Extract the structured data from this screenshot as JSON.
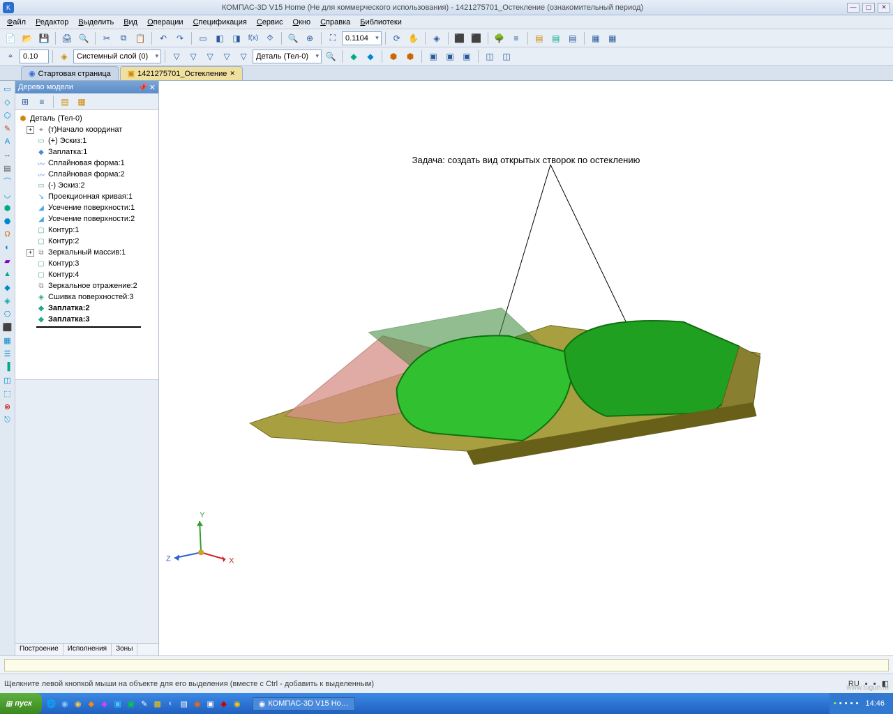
{
  "title": "КОМПАС-3D V15 Home (Не для коммерческого использования) - 1421275701_Остекление (ознакомительный период)",
  "menu": [
    "Файл",
    "Редактор",
    "Выделить",
    "Вид",
    "Операции",
    "Спецификация",
    "Сервис",
    "Окно",
    "Справка",
    "Библиотеки"
  ],
  "zoom_value": "0.1104",
  "scale_value": "0.10",
  "layer_value": "Системный слой (0)",
  "part_value": "Деталь (Тел-0)",
  "tabs": [
    {
      "label": "Стартовая страница",
      "active": false
    },
    {
      "label": "1421275701_Остекление",
      "active": true
    }
  ],
  "tree_title": "Дерево модели",
  "tree": {
    "root": "Деталь (Тел-0)",
    "items": [
      {
        "label": "(т)Начало координат",
        "exp": "+",
        "icon": "⌖",
        "color": "#555"
      },
      {
        "label": "(+) Эскиз:1",
        "icon": "▭",
        "color": "#5a8"
      },
      {
        "label": "Заплатка:1",
        "icon": "◆",
        "color": "#4a88d8"
      },
      {
        "label": "Сплайновая форма:1",
        "icon": "〰",
        "color": "#4a88d8"
      },
      {
        "label": "Сплайновая форма:2",
        "icon": "〰",
        "color": "#4a88d8"
      },
      {
        "label": "(-) Эскиз:2",
        "icon": "▭",
        "color": "#5a8"
      },
      {
        "label": "Проекционная кривая:1",
        "icon": "↘",
        "color": "#4a88d8"
      },
      {
        "label": "Усечение поверхности:1",
        "icon": "◢",
        "color": "#4aa8d8"
      },
      {
        "label": "Усечение поверхности:2",
        "icon": "◢",
        "color": "#4aa8d8"
      },
      {
        "label": "Контур:1",
        "icon": "▢",
        "color": "#5a8"
      },
      {
        "label": "Контур:2",
        "icon": "▢",
        "color": "#5a8"
      },
      {
        "label": "Зеркальный массив:1",
        "exp": "+",
        "icon": "⧉",
        "color": "#888"
      },
      {
        "label": "Контур:3",
        "icon": "▢",
        "color": "#5a8"
      },
      {
        "label": "Контур:4",
        "icon": "▢",
        "color": "#5a8"
      },
      {
        "label": "Зеркальное отражение:2",
        "icon": "⧉",
        "color": "#888"
      },
      {
        "label": "Сшивка поверхностей:3",
        "icon": "◈",
        "color": "#2a8"
      },
      {
        "label": "Заплатка:2",
        "icon": "◆",
        "color": "#2a8",
        "bold": true
      },
      {
        "label": "Заплатка:3",
        "icon": "◆",
        "color": "#2a8",
        "bold": true
      }
    ]
  },
  "tree_tabs": [
    "Построение",
    "Исполнения",
    "Зоны"
  ],
  "annotation": "Задача: создать вид открытых створок по остеклению",
  "axes": {
    "x": "X",
    "y": "Y",
    "z": "Z"
  },
  "status_text": "Щелкните левой кнопкой мыши на объекте для его выделения (вместе с Ctrl - добавить к выделенным)",
  "status_lang": "RU",
  "taskbar": {
    "start": "пуск",
    "app": "КОМПАС-3D V15 Ho…",
    "time": "14:46"
  },
  "watermark": "www.tugun.ru"
}
